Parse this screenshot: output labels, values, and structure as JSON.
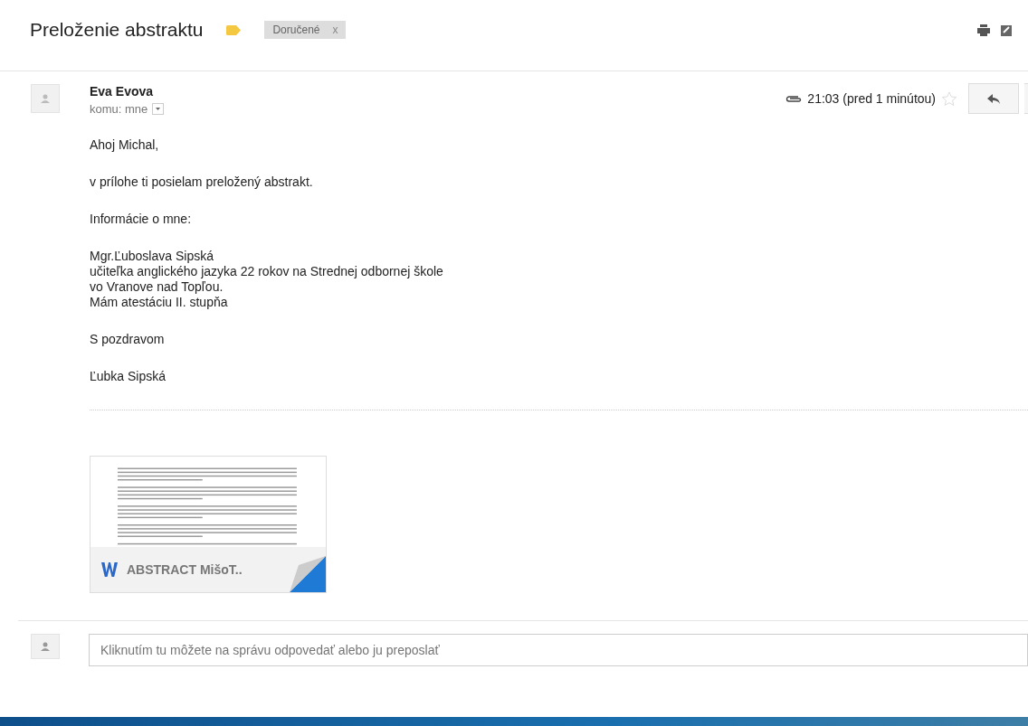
{
  "subject": "Preloženie abstraktu",
  "labels": [
    {
      "text": "Doručené",
      "remove": "x"
    }
  ],
  "message": {
    "sender": "Eva Evova",
    "recipient": "komu: mne",
    "time": "21:03 (pred 1 minútou)",
    "has_attachment": true,
    "starred": false,
    "paragraphs": [
      [
        "Ahoj Michal,"
      ],
      [
        "v prílohe ti posielam preložený abstrakt."
      ],
      [
        "Informácie o mne:"
      ],
      [
        "Mgr.Ľuboslava Sipská",
        "učiteľka anglického jazyka 22 rokov na Strednej odbornej škole",
        "vo Vranove nad Topľou.",
        "Mám atestáciu II. stupňa"
      ],
      [
        "S pozdravom"
      ]
    ],
    "signature": "Ľubka Sipská",
    "attachments": [
      {
        "name": "ABSTRACT MišoT..",
        "kind": "word"
      }
    ]
  },
  "reply": {
    "placeholder": "Kliknutím tu môžete na správu odpovedať alebo ju preposlať"
  }
}
